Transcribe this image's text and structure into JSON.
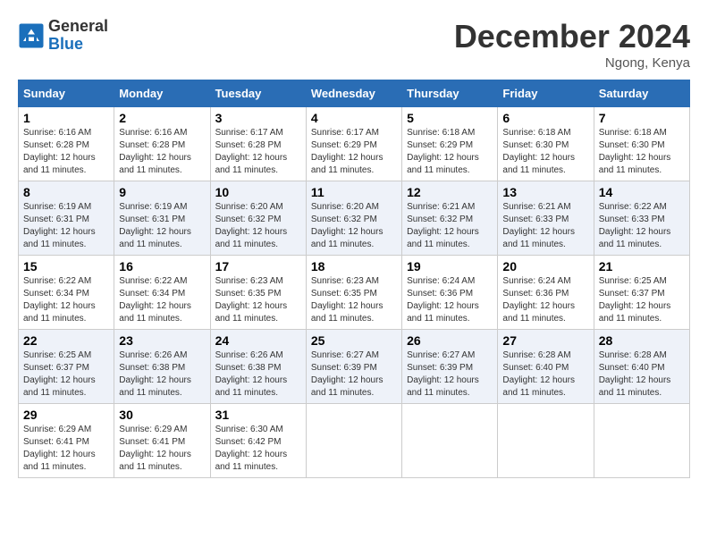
{
  "header": {
    "logo_line1": "General",
    "logo_line2": "Blue",
    "month_title": "December 2024",
    "location": "Ngong, Kenya"
  },
  "days_of_week": [
    "Sunday",
    "Monday",
    "Tuesday",
    "Wednesday",
    "Thursday",
    "Friday",
    "Saturday"
  ],
  "weeks": [
    [
      {
        "day": "1",
        "sunrise": "6:16 AM",
        "sunset": "6:28 PM",
        "daylight": "12 hours and 11 minutes."
      },
      {
        "day": "2",
        "sunrise": "6:16 AM",
        "sunset": "6:28 PM",
        "daylight": "12 hours and 11 minutes."
      },
      {
        "day": "3",
        "sunrise": "6:17 AM",
        "sunset": "6:28 PM",
        "daylight": "12 hours and 11 minutes."
      },
      {
        "day": "4",
        "sunrise": "6:17 AM",
        "sunset": "6:29 PM",
        "daylight": "12 hours and 11 minutes."
      },
      {
        "day": "5",
        "sunrise": "6:18 AM",
        "sunset": "6:29 PM",
        "daylight": "12 hours and 11 minutes."
      },
      {
        "day": "6",
        "sunrise": "6:18 AM",
        "sunset": "6:30 PM",
        "daylight": "12 hours and 11 minutes."
      },
      {
        "day": "7",
        "sunrise": "6:18 AM",
        "sunset": "6:30 PM",
        "daylight": "12 hours and 11 minutes."
      }
    ],
    [
      {
        "day": "8",
        "sunrise": "6:19 AM",
        "sunset": "6:31 PM",
        "daylight": "12 hours and 11 minutes."
      },
      {
        "day": "9",
        "sunrise": "6:19 AM",
        "sunset": "6:31 PM",
        "daylight": "12 hours and 11 minutes."
      },
      {
        "day": "10",
        "sunrise": "6:20 AM",
        "sunset": "6:32 PM",
        "daylight": "12 hours and 11 minutes."
      },
      {
        "day": "11",
        "sunrise": "6:20 AM",
        "sunset": "6:32 PM",
        "daylight": "12 hours and 11 minutes."
      },
      {
        "day": "12",
        "sunrise": "6:21 AM",
        "sunset": "6:32 PM",
        "daylight": "12 hours and 11 minutes."
      },
      {
        "day": "13",
        "sunrise": "6:21 AM",
        "sunset": "6:33 PM",
        "daylight": "12 hours and 11 minutes."
      },
      {
        "day": "14",
        "sunrise": "6:22 AM",
        "sunset": "6:33 PM",
        "daylight": "12 hours and 11 minutes."
      }
    ],
    [
      {
        "day": "15",
        "sunrise": "6:22 AM",
        "sunset": "6:34 PM",
        "daylight": "12 hours and 11 minutes."
      },
      {
        "day": "16",
        "sunrise": "6:22 AM",
        "sunset": "6:34 PM",
        "daylight": "12 hours and 11 minutes."
      },
      {
        "day": "17",
        "sunrise": "6:23 AM",
        "sunset": "6:35 PM",
        "daylight": "12 hours and 11 minutes."
      },
      {
        "day": "18",
        "sunrise": "6:23 AM",
        "sunset": "6:35 PM",
        "daylight": "12 hours and 11 minutes."
      },
      {
        "day": "19",
        "sunrise": "6:24 AM",
        "sunset": "6:36 PM",
        "daylight": "12 hours and 11 minutes."
      },
      {
        "day": "20",
        "sunrise": "6:24 AM",
        "sunset": "6:36 PM",
        "daylight": "12 hours and 11 minutes."
      },
      {
        "day": "21",
        "sunrise": "6:25 AM",
        "sunset": "6:37 PM",
        "daylight": "12 hours and 11 minutes."
      }
    ],
    [
      {
        "day": "22",
        "sunrise": "6:25 AM",
        "sunset": "6:37 PM",
        "daylight": "12 hours and 11 minutes."
      },
      {
        "day": "23",
        "sunrise": "6:26 AM",
        "sunset": "6:38 PM",
        "daylight": "12 hours and 11 minutes."
      },
      {
        "day": "24",
        "sunrise": "6:26 AM",
        "sunset": "6:38 PM",
        "daylight": "12 hours and 11 minutes."
      },
      {
        "day": "25",
        "sunrise": "6:27 AM",
        "sunset": "6:39 PM",
        "daylight": "12 hours and 11 minutes."
      },
      {
        "day": "26",
        "sunrise": "6:27 AM",
        "sunset": "6:39 PM",
        "daylight": "12 hours and 11 minutes."
      },
      {
        "day": "27",
        "sunrise": "6:28 AM",
        "sunset": "6:40 PM",
        "daylight": "12 hours and 11 minutes."
      },
      {
        "day": "28",
        "sunrise": "6:28 AM",
        "sunset": "6:40 PM",
        "daylight": "12 hours and 11 minutes."
      }
    ],
    [
      {
        "day": "29",
        "sunrise": "6:29 AM",
        "sunset": "6:41 PM",
        "daylight": "12 hours and 11 minutes."
      },
      {
        "day": "30",
        "sunrise": "6:29 AM",
        "sunset": "6:41 PM",
        "daylight": "12 hours and 11 minutes."
      },
      {
        "day": "31",
        "sunrise": "6:30 AM",
        "sunset": "6:42 PM",
        "daylight": "12 hours and 11 minutes."
      },
      null,
      null,
      null,
      null
    ]
  ],
  "labels": {
    "sunrise": "Sunrise:",
    "sunset": "Sunset:",
    "daylight": "Daylight:"
  }
}
